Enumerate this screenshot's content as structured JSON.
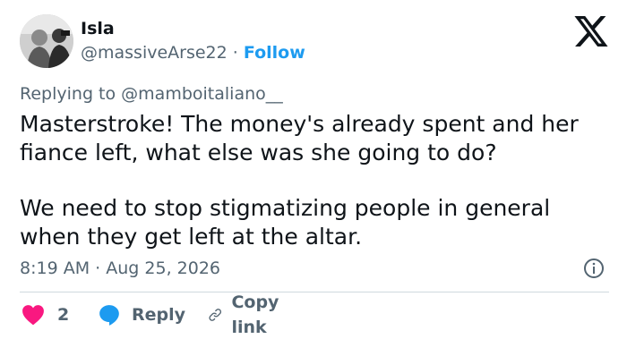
{
  "author": {
    "name": "Isla",
    "handle": "@massiveArse22",
    "separator": "·",
    "follow_label": "Follow"
  },
  "reply_context": {
    "prefix": "Replying to",
    "mention": "@mamboitaliano__"
  },
  "tweet": {
    "lines_paragraph1": [
      "Masterstroke! The money's already spent and her",
      "fiance left, what else was she going to do?"
    ],
    "lines_paragraph2": [
      "We need to stop stigmatizing people in general",
      "when they get left at the altar."
    ]
  },
  "meta": {
    "time": "8:19 AM",
    "separator": "·",
    "date": "Aug 25, 2026"
  },
  "actions": {
    "like_count": "2",
    "reply_label": "Reply",
    "copy_label": "Copy link"
  },
  "icons": {
    "logo": "x-logo-icon",
    "info": "info-icon",
    "like": "heart-icon",
    "reply": "speech-bubble-icon",
    "copy": "link-icon"
  },
  "colors": {
    "text": "#0f1419",
    "secondary": "#536471",
    "accent": "#1d9bf0",
    "like": "#f91880",
    "divider": "#cfd9de"
  }
}
